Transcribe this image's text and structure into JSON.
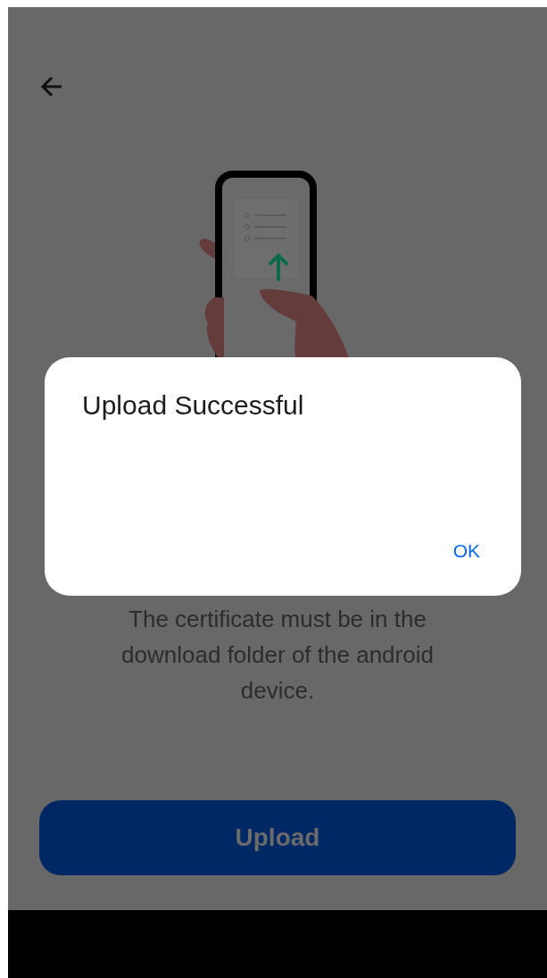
{
  "screen": {
    "message": "The certificate must be in the download folder of the android device.",
    "button": "Upload"
  },
  "dialog": {
    "title": "Upload Successful",
    "actions": [
      "OK"
    ]
  }
}
